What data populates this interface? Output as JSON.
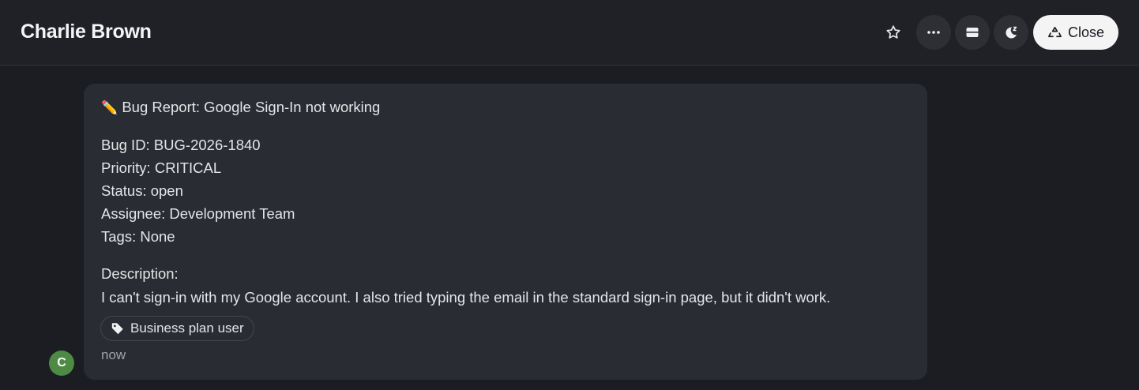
{
  "header": {
    "title": "Charlie Brown",
    "actions": {
      "star_icon": "star-icon",
      "more_icon": "more-horizontal-icon",
      "archive_icon": "archive-icon",
      "snooze_icon": "snooze-icon",
      "close_label": "Close",
      "close_icon": "recycle-icon"
    }
  },
  "message": {
    "title_emoji": "✏️",
    "title": "Bug Report: Google Sign-In not working",
    "bug_id": "Bug ID: BUG-2026-1840",
    "priority": "Priority: CRITICAL",
    "status": "Status: open",
    "assignee": "Assignee: Development Team",
    "tags": "Tags: None",
    "description_label": "Description:",
    "description": "I can't sign-in with my Google account. I also tried typing the email in the standard sign-in page, but it didn't work.",
    "tag_label": "Business plan user",
    "timestamp": "now"
  },
  "avatar": {
    "initial": "C",
    "color": "#4d8a43"
  }
}
